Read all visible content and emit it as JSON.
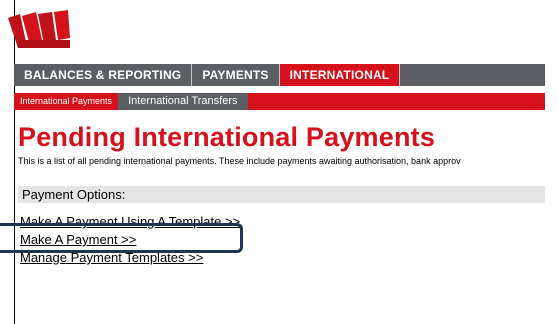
{
  "nav": {
    "items": [
      {
        "label": "BALANCES & REPORTING",
        "active": false
      },
      {
        "label": "PAYMENTS",
        "active": false
      },
      {
        "label": "INTERNATIONAL",
        "active": true
      }
    ]
  },
  "subnav": {
    "items": [
      {
        "label": "International Payments",
        "active": true
      },
      {
        "label": "International Transfers",
        "active": false
      }
    ]
  },
  "page": {
    "title": "Pending International Payments",
    "description": "This is a list of all pending international payments. These include payments awaiting authorisation, bank approv"
  },
  "options": {
    "header": "Payment Options:",
    "links": [
      "Make A Payment Using A Template >>",
      "Make A Payment >>",
      "Manage Payment Templates >>"
    ]
  },
  "colors": {
    "brand_red": "#d5111b",
    "nav_gray": "#5b5f63",
    "highlight_navy": "#1b3553"
  }
}
